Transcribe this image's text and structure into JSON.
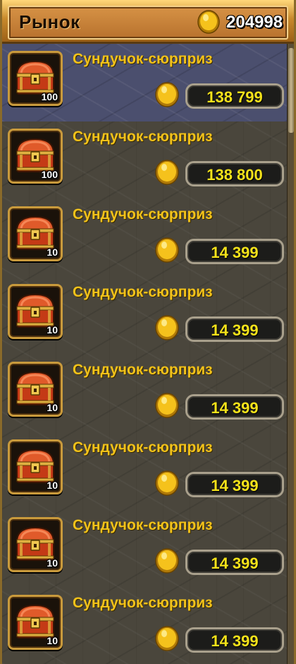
{
  "header": {
    "title": "Рынок",
    "balance": "204998",
    "coin_icon": "gold-coin-icon"
  },
  "colors": {
    "title_text": "#1a0e02",
    "item_name": "#f2c21a",
    "price_text": "#f4e21a",
    "selected_row": "#4b4f6e",
    "frame_gold": "#c99a3c"
  },
  "items": [
    {
      "name": "Сундучок-сюрприз",
      "qty": "100",
      "price": "138 799",
      "icon": "treasure-chest-icon",
      "selected": true
    },
    {
      "name": "Сундучок-сюрприз",
      "qty": "100",
      "price": "138 800",
      "icon": "treasure-chest-icon",
      "selected": false
    },
    {
      "name": "Сундучок-сюрприз",
      "qty": "10",
      "price": "14 399",
      "icon": "treasure-chest-icon",
      "selected": false
    },
    {
      "name": "Сундучок-сюрприз",
      "qty": "10",
      "price": "14 399",
      "icon": "treasure-chest-icon",
      "selected": false
    },
    {
      "name": "Сундучок-сюрприз",
      "qty": "10",
      "price": "14 399",
      "icon": "treasure-chest-icon",
      "selected": false
    },
    {
      "name": "Сундучок-сюрприз",
      "qty": "10",
      "price": "14 399",
      "icon": "treasure-chest-icon",
      "selected": false
    },
    {
      "name": "Сундучок-сюрприз",
      "qty": "10",
      "price": "14 399",
      "icon": "treasure-chest-icon",
      "selected": false
    },
    {
      "name": "Сундучок-сюрприз",
      "qty": "10",
      "price": "14 399",
      "icon": "treasure-chest-icon",
      "selected": false
    }
  ]
}
